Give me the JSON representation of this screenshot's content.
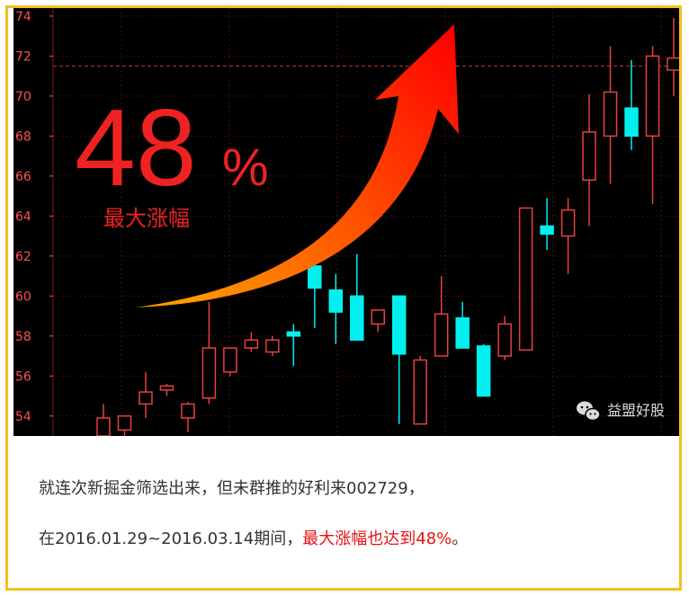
{
  "overlay": {
    "percent_number": "48",
    "percent_sign": "%",
    "subtitle": "最大涨幅"
  },
  "watermark": {
    "text": "益盟好股",
    "icon": "wechat-icon"
  },
  "caption": {
    "line1": "就连次新掘金筛选出来，但未群推的好利来002729，",
    "line2_prefix": "在2016.01.29~2016.03.14期间，",
    "line2_highlight": "最大涨幅也达到48%",
    "line2_suffix": "。"
  },
  "colors": {
    "background": "#000000",
    "up_candle": "#e84040",
    "down_candle": "#00f0f0",
    "axis_text": "#ff5050",
    "grid": "#7a1a1a",
    "arrow_start": "#ffaa00",
    "arrow_end": "#ff0000",
    "frame": "#f2c21a",
    "highlight_text": "#e81010"
  },
  "chart_data": {
    "type": "candlestick",
    "y_ticks": [
      54,
      56,
      58,
      60,
      62,
      64,
      66,
      68,
      70,
      72,
      74
    ],
    "ylim": [
      53.0,
      74.4
    ],
    "reference_line": 71.5,
    "grid": true,
    "candles": [
      {
        "open": 53.9,
        "high": 54.6,
        "low": 53.0,
        "close": 53.0,
        "dir": "up"
      },
      {
        "open": 53.3,
        "high": 54.0,
        "low": 53.0,
        "close": 54.0,
        "dir": "up"
      },
      {
        "open": 54.6,
        "high": 56.2,
        "low": 53.9,
        "close": 55.2,
        "dir": "up"
      },
      {
        "open": 55.3,
        "high": 55.6,
        "low": 55.0,
        "close": 55.5,
        "dir": "up"
      },
      {
        "open": 53.9,
        "high": 54.7,
        "low": 53.2,
        "close": 54.6,
        "dir": "up"
      },
      {
        "open": 54.9,
        "high": 59.7,
        "low": 54.6,
        "close": 57.4,
        "dir": "up"
      },
      {
        "open": 56.2,
        "high": 57.4,
        "low": 56.0,
        "close": 57.4,
        "dir": "up"
      },
      {
        "open": 57.4,
        "high": 58.2,
        "low": 57.2,
        "close": 57.8,
        "dir": "up"
      },
      {
        "open": 57.2,
        "high": 58.0,
        "low": 57.0,
        "close": 57.8,
        "dir": "up"
      },
      {
        "open": 58.2,
        "high": 58.6,
        "low": 56.5,
        "close": 58.0,
        "dir": "down"
      },
      {
        "open": 61.5,
        "high": 61.5,
        "low": 58.4,
        "close": 60.4,
        "dir": "down"
      },
      {
        "open": 60.3,
        "high": 61.1,
        "low": 57.6,
        "close": 59.2,
        "dir": "down"
      },
      {
        "open": 60.0,
        "high": 62.1,
        "low": 57.8,
        "close": 57.8,
        "dir": "down"
      },
      {
        "open": 58.6,
        "high": 59.3,
        "low": 58.2,
        "close": 59.3,
        "dir": "up"
      },
      {
        "open": 60.0,
        "high": 60.0,
        "low": 53.6,
        "close": 57.1,
        "dir": "down"
      },
      {
        "open": 53.6,
        "high": 57.0,
        "low": 53.6,
        "close": 56.8,
        "dir": "up"
      },
      {
        "open": 57.0,
        "high": 61.0,
        "low": 57.0,
        "close": 59.1,
        "dir": "up"
      },
      {
        "open": 58.9,
        "high": 59.7,
        "low": 57.4,
        "close": 57.4,
        "dir": "down"
      },
      {
        "open": 57.5,
        "high": 57.6,
        "low": 55.0,
        "close": 55.0,
        "dir": "down"
      },
      {
        "open": 57.0,
        "high": 59.0,
        "low": 56.8,
        "close": 58.6,
        "dir": "up"
      },
      {
        "open": 57.3,
        "high": 64.4,
        "low": 57.3,
        "close": 64.4,
        "dir": "up"
      },
      {
        "open": 63.5,
        "high": 64.9,
        "low": 62.3,
        "close": 63.1,
        "dir": "down"
      },
      {
        "open": 63.0,
        "high": 64.9,
        "low": 61.1,
        "close": 64.3,
        "dir": "up"
      },
      {
        "open": 65.8,
        "high": 70.1,
        "low": 63.5,
        "close": 68.2,
        "dir": "up"
      },
      {
        "open": 68.0,
        "high": 72.5,
        "low": 65.6,
        "close": 70.2,
        "dir": "up"
      },
      {
        "open": 69.4,
        "high": 71.8,
        "low": 67.3,
        "close": 68.0,
        "dir": "down"
      },
      {
        "open": 68.0,
        "high": 72.5,
        "low": 64.6,
        "close": 72.0,
        "dir": "up"
      },
      {
        "open": 71.3,
        "high": 73.9,
        "low": 70.0,
        "close": 71.9,
        "dir": "up"
      }
    ]
  }
}
